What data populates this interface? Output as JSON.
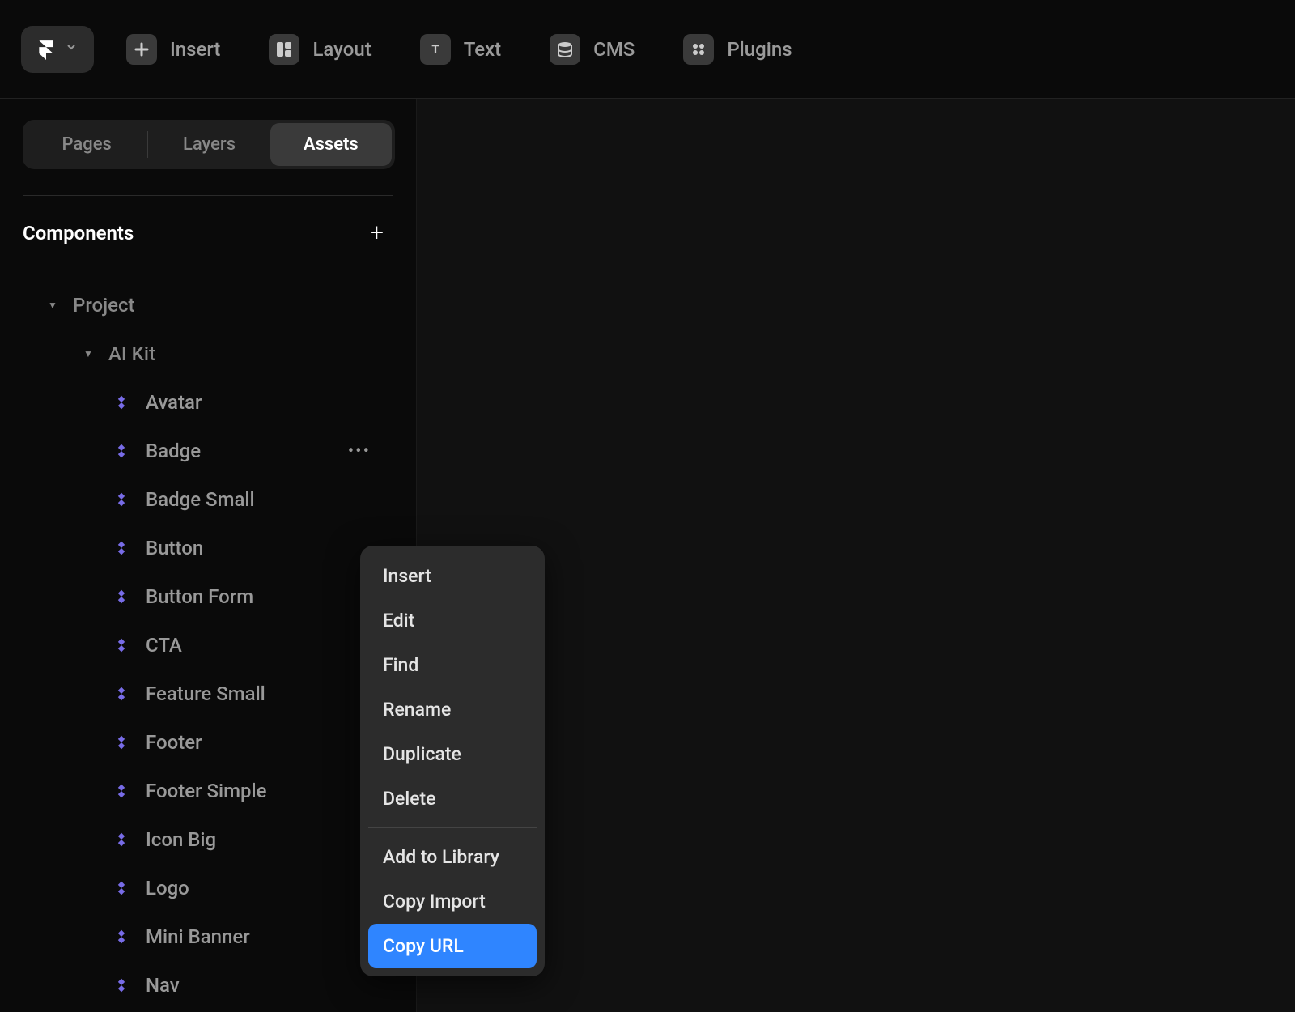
{
  "toolbar": {
    "items": [
      {
        "label": "Insert",
        "icon": "plus"
      },
      {
        "label": "Layout",
        "icon": "layout"
      },
      {
        "label": "Text",
        "icon": "text"
      },
      {
        "label": "CMS",
        "icon": "cms"
      },
      {
        "label": "Plugins",
        "icon": "plugins"
      }
    ]
  },
  "sidebar": {
    "tabs": [
      "Pages",
      "Layers",
      "Assets"
    ],
    "activeTab": "Assets",
    "section_title": "Components",
    "tree": {
      "folder_0": "Project",
      "folder_1": "AI Kit",
      "components": [
        "Avatar",
        "Badge",
        "Badge Small",
        "Button",
        "Button Form",
        "CTA",
        "Feature Small",
        "Footer",
        "Footer Simple",
        "Icon Big",
        "Logo",
        "Mini Banner",
        "Nav"
      ],
      "active_component_index": 1
    }
  },
  "context_menu": {
    "group1": [
      "Insert",
      "Edit",
      "Find",
      "Rename",
      "Duplicate",
      "Delete"
    ],
    "group2": [
      "Add to Library",
      "Copy Import",
      "Copy URL"
    ],
    "highlighted": "Copy URL"
  },
  "colors": {
    "accent": "#2f85ff",
    "component_icon": "#8477ff"
  }
}
